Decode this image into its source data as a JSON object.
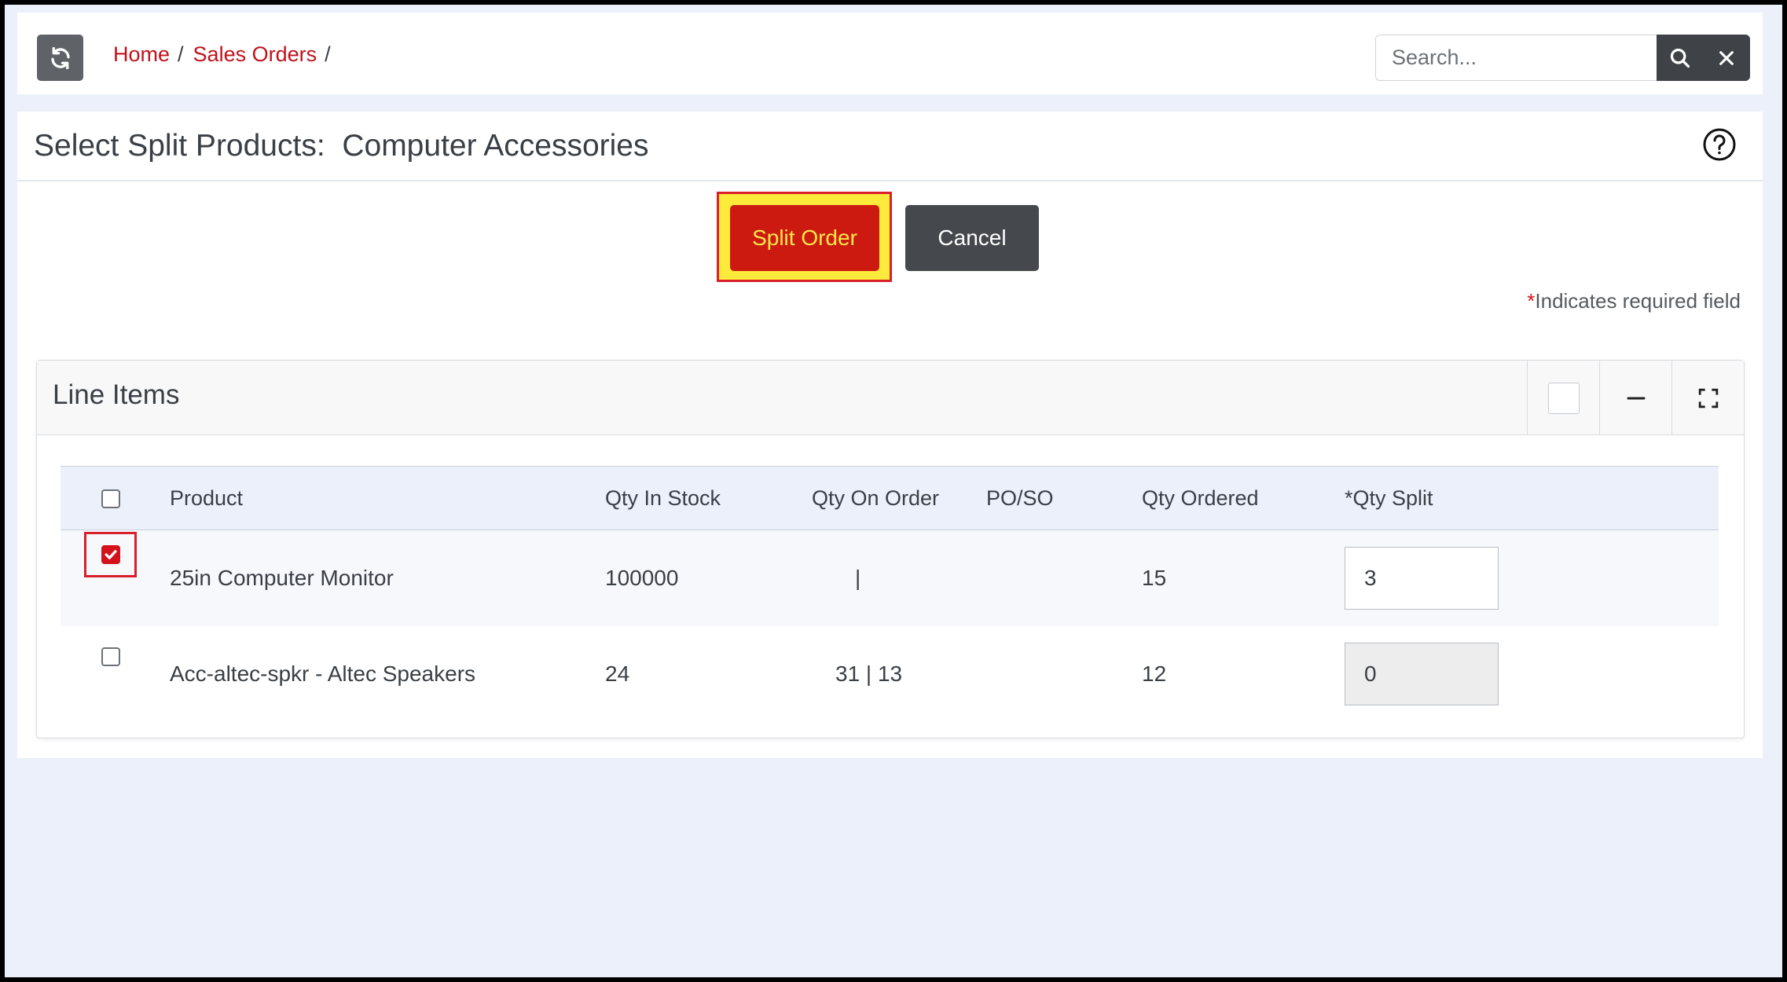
{
  "breadcrumb": [
    {
      "label": "Home"
    },
    {
      "label": "Sales Orders"
    }
  ],
  "breadcrumb_sep": "/",
  "search": {
    "placeholder": "Search..."
  },
  "page": {
    "title_prefix": "Select Split Products:",
    "title_name": "Computer Accessories"
  },
  "actions": {
    "split_label": "Split Order",
    "cancel_label": "Cancel"
  },
  "required_note": {
    "star": "*",
    "text": "Indicates required field"
  },
  "card": {
    "title": "Line Items"
  },
  "table": {
    "headers": {
      "product": "Product",
      "qty_in_stock": "Qty In Stock",
      "qty_on_order": "Qty On Order",
      "po_so": "PO/SO",
      "qty_ordered": "Qty Ordered",
      "qty_split": "*Qty Split"
    },
    "rows": [
      {
        "checked": true,
        "product": "25in Computer Monitor",
        "qty_in_stock": "100000",
        "qty_on_order": "|",
        "po_so": "",
        "qty_ordered": "15",
        "qty_split": "3"
      },
      {
        "checked": false,
        "product": "Acc-altec-spkr - Altec Speakers",
        "qty_in_stock": "24",
        "qty_on_order": "31 | 13",
        "po_so": "",
        "qty_ordered": "12",
        "qty_split": "0"
      }
    ]
  },
  "colors": {
    "accent_red": "#c0121b",
    "split_button_bg": "#cc1a10",
    "split_button_text": "#fbe84a",
    "highlight_yellow": "#fdeb3c",
    "dark_button": "#45484c",
    "page_bg": "#ecf0fb"
  }
}
